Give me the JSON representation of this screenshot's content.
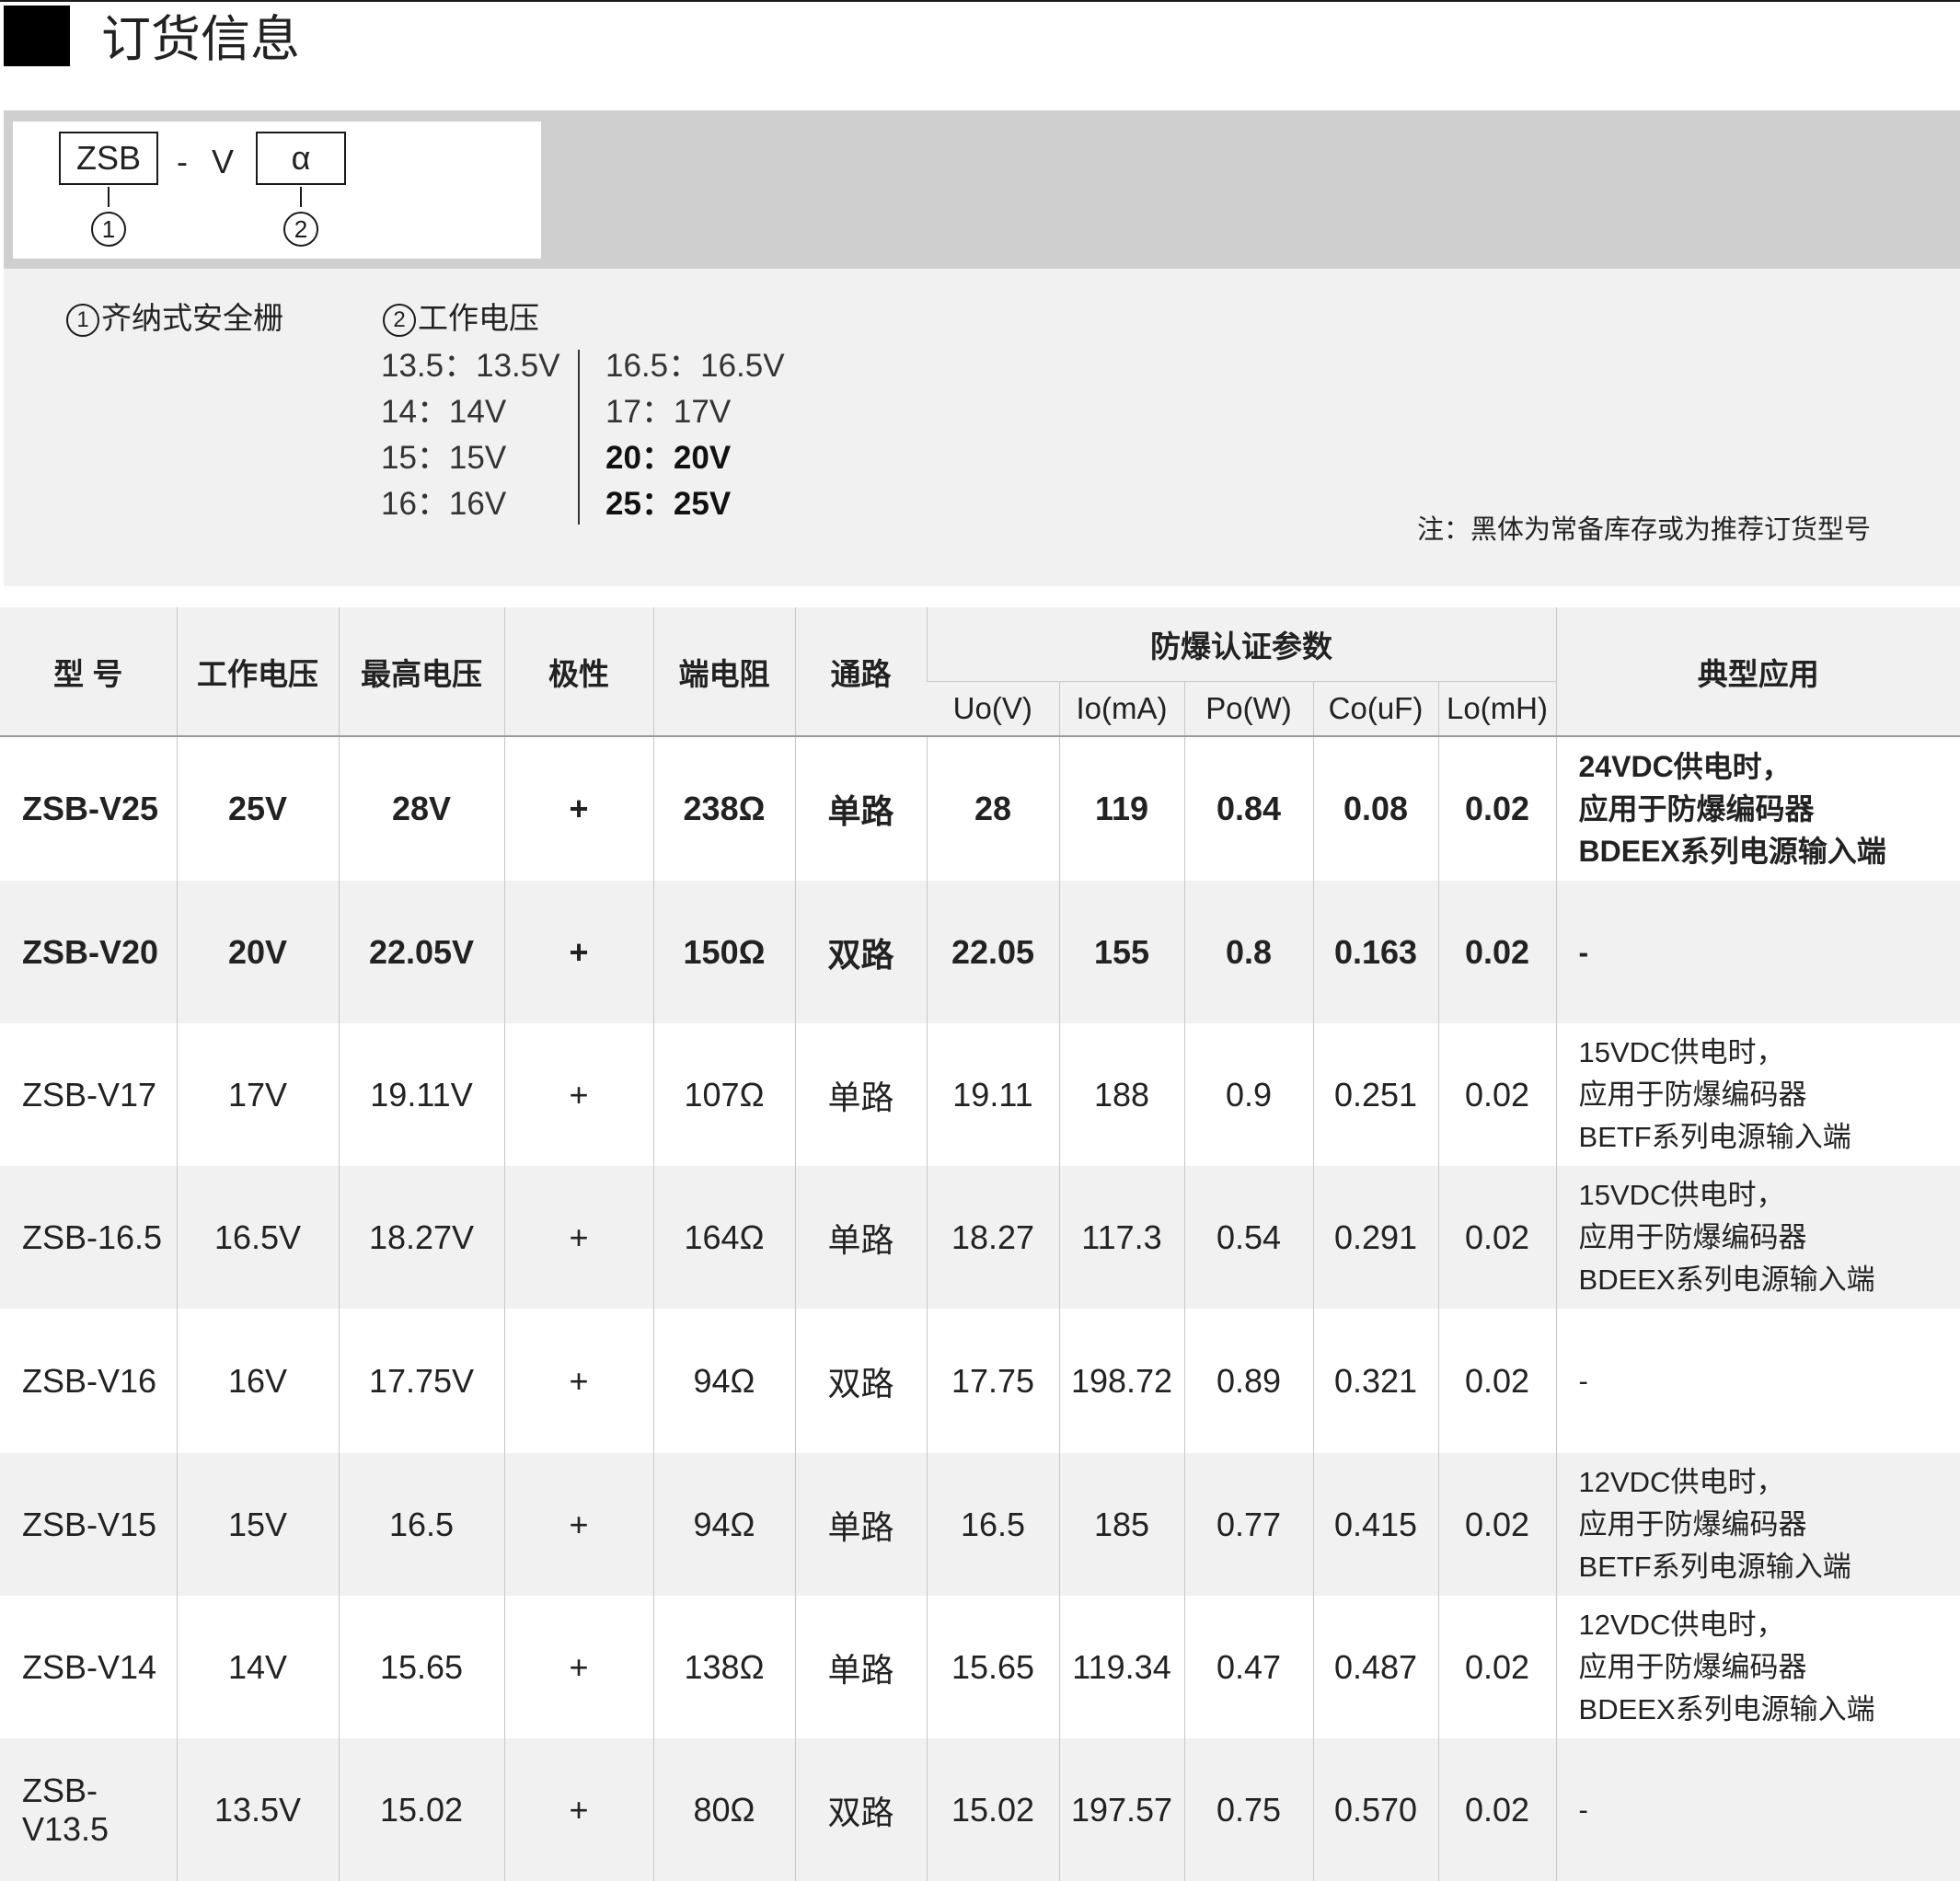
{
  "header": {
    "title": "订货信息"
  },
  "code": {
    "box1": "ZSB",
    "separator": "- V",
    "box2": "α",
    "marker1": "1",
    "marker2": "2"
  },
  "options": {
    "item1_num": "1",
    "item1_label": "齐纳式安全栅",
    "item2_num": "2",
    "item2_label": "工作电压",
    "voltages_left": [
      {
        "text": "13.5：13.5V",
        "bold": false
      },
      {
        "text": "14：14V",
        "bold": false
      },
      {
        "text": "15：15V",
        "bold": false
      },
      {
        "text": "16：16V",
        "bold": false
      }
    ],
    "voltages_right": [
      {
        "text": "16.5：16.5V",
        "bold": false
      },
      {
        "text": "17：17V",
        "bold": false
      },
      {
        "text": "20：20V",
        "bold": true
      },
      {
        "text": "25：25V",
        "bold": true
      }
    ],
    "note": "注：黑体为常备库存或为推荐订货型号"
  },
  "table": {
    "headers": {
      "model": "型  号",
      "working_voltage": "工作电压",
      "max_voltage": "最高电压",
      "polarity": "极性",
      "terminal_resistance": "端电阻",
      "channel": "通路",
      "ex_group": "防爆认证参数",
      "uo": "Uo(V)",
      "io": "Io(mA)",
      "po": "Po(W)",
      "co": "Co(uF)",
      "lo": "Lo(mH)",
      "application": "典型应用"
    },
    "rows": [
      {
        "model": "ZSB-V25",
        "wv": "25V",
        "mv": "28V",
        "pol": "+",
        "res": "238Ω",
        "ch": "单路",
        "uo": "28",
        "io": "119",
        "po": "0.84",
        "co": "0.08",
        "lo": "0.02",
        "app": [
          "24VDC供电时，",
          "应用于防爆编码器",
          "BDEEX系列电源输入端"
        ],
        "bold": true
      },
      {
        "model": "ZSB-V20",
        "wv": "20V",
        "mv": "22.05V",
        "pol": "+",
        "res": "150Ω",
        "ch": "双路",
        "uo": "22.05",
        "io": "155",
        "po": "0.8",
        "co": "0.163",
        "lo": "0.02",
        "app": [
          "-"
        ],
        "bold": true
      },
      {
        "model": "ZSB-V17",
        "wv": "17V",
        "mv": "19.11V",
        "pol": "+",
        "res": "107Ω",
        "ch": "单路",
        "uo": "19.11",
        "io": "188",
        "po": "0.9",
        "co": "0.251",
        "lo": "0.02",
        "app": [
          "15VDC供电时，",
          "应用于防爆编码器",
          "BETF系列电源输入端"
        ],
        "bold": false
      },
      {
        "model": "ZSB-16.5",
        "wv": "16.5V",
        "mv": "18.27V",
        "pol": "+",
        "res": "164Ω",
        "ch": "单路",
        "uo": "18.27",
        "io": "117.3",
        "po": "0.54",
        "co": "0.291",
        "lo": "0.02",
        "app": [
          "15VDC供电时，",
          "应用于防爆编码器",
          "BDEEX系列电源输入端"
        ],
        "bold": false
      },
      {
        "model": "ZSB-V16",
        "wv": "16V",
        "mv": "17.75V",
        "pol": "+",
        "res": "94Ω",
        "ch": "双路",
        "uo": "17.75",
        "io": "198.72",
        "po": "0.89",
        "co": "0.321",
        "lo": "0.02",
        "app": [
          "-"
        ],
        "bold": false
      },
      {
        "model": "ZSB-V15",
        "wv": "15V",
        "mv": "16.5",
        "pol": "+",
        "res": "94Ω",
        "ch": "单路",
        "uo": "16.5",
        "io": "185",
        "po": "0.77",
        "co": "0.415",
        "lo": "0.02",
        "app": [
          "12VDC供电时，",
          "应用于防爆编码器",
          "BETF系列电源输入端"
        ],
        "bold": false
      },
      {
        "model": "ZSB-V14",
        "wv": "14V",
        "mv": "15.65",
        "pol": "+",
        "res": "138Ω",
        "ch": "单路",
        "uo": "15.65",
        "io": "119.34",
        "po": "0.47",
        "co": "0.487",
        "lo": "0.02",
        "app": [
          "12VDC供电时，",
          "应用于防爆编码器",
          "BDEEX系列电源输入端"
        ],
        "bold": false
      },
      {
        "model": "ZSB-V13.5",
        "wv": "13.5V",
        "mv": "15.02",
        "pol": "+",
        "res": "80Ω",
        "ch": "双路",
        "uo": "15.02",
        "io": "197.57",
        "po": "0.75",
        "co": "0.570",
        "lo": "0.02",
        "app": [
          "-"
        ],
        "bold": false
      }
    ]
  }
}
